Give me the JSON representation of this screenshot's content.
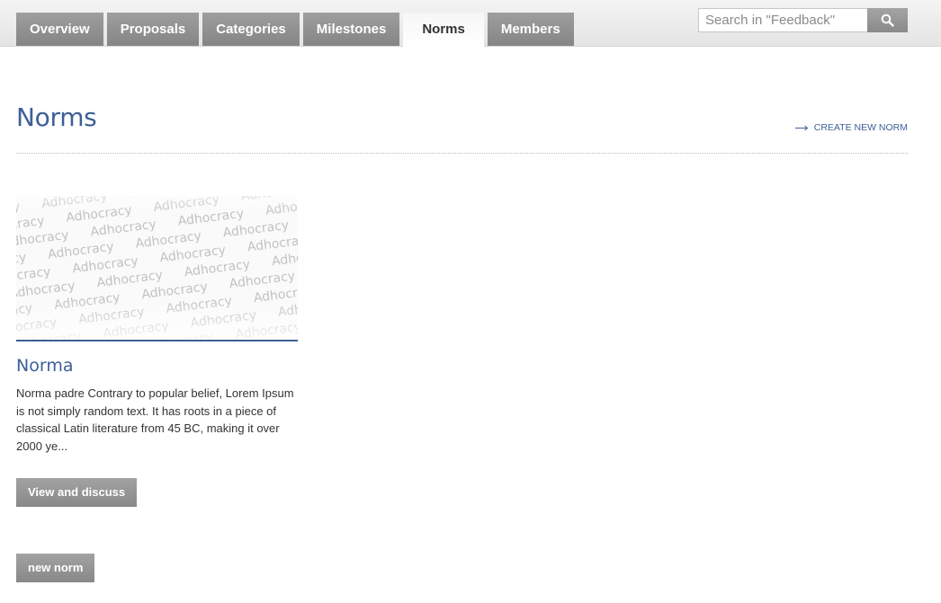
{
  "nav": {
    "tabs": [
      {
        "label": "Overview"
      },
      {
        "label": "Proposals"
      },
      {
        "label": "Categories"
      },
      {
        "label": "Milestones"
      },
      {
        "label": "Norms",
        "active": true
      },
      {
        "label": "Members"
      }
    ]
  },
  "search": {
    "placeholder": "Search in \"Feedback\"",
    "value": "",
    "icon": "search-icon"
  },
  "page": {
    "title": "Norms",
    "create_link_label": "CREATE NEW NORM",
    "create_link_icon": "long-arrow-right-icon"
  },
  "norm_card": {
    "image_word": "Adhocracy",
    "title": "Norma",
    "excerpt": "Norma padre Contrary to popular belief, Lorem Ipsum is not simply random text. It has roots in a piece of classical Latin literature from 45 BC, making it over 2000 ye...",
    "view_button_label": "View and discuss"
  },
  "footer": {
    "new_norm_button_label": "new norm"
  },
  "colors": {
    "accent": "#3d5f96",
    "tab_bg": "#8f8f8f",
    "button_bg": "#959595",
    "text": "#333333"
  }
}
